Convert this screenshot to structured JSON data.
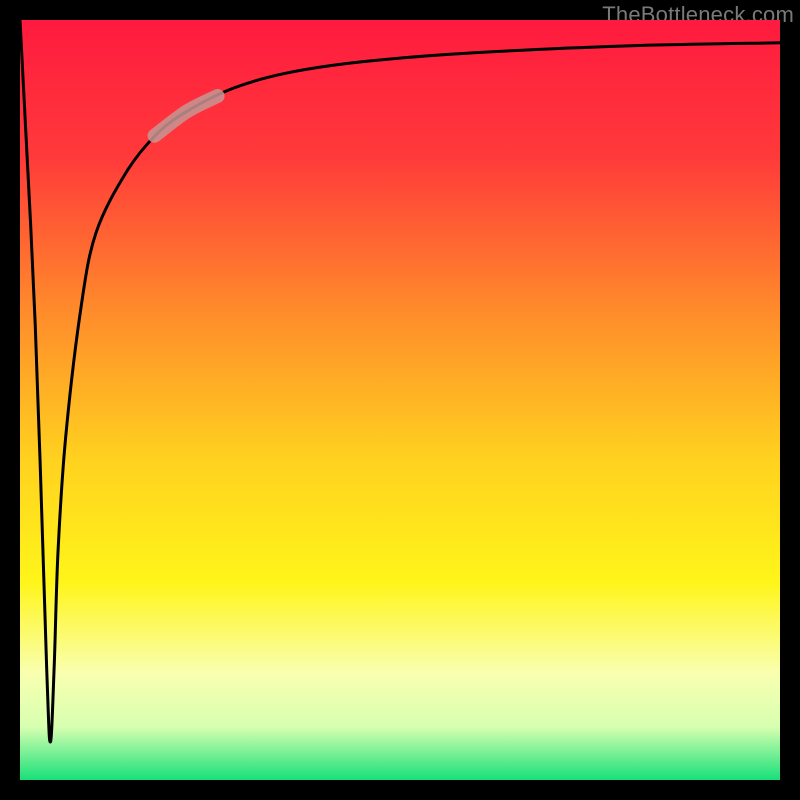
{
  "watermark": "TheBottleneck.com",
  "colors": {
    "frame_bg": "#000000",
    "watermark": "#7a7a7a",
    "curve": "#000000",
    "highlight": "#c79693",
    "gradient_stops": [
      {
        "pct": 0,
        "color": "#ff1a3f"
      },
      {
        "pct": 18,
        "color": "#ff3a3a"
      },
      {
        "pct": 38,
        "color": "#ff8a2b"
      },
      {
        "pct": 58,
        "color": "#ffd21f"
      },
      {
        "pct": 74,
        "color": "#fff51a"
      },
      {
        "pct": 86,
        "color": "#f9ffb0"
      },
      {
        "pct": 93,
        "color": "#d7ffb0"
      },
      {
        "pct": 100,
        "color": "#18e07a"
      }
    ]
  },
  "chart_data": {
    "type": "line",
    "title": "",
    "xlabel": "",
    "ylabel": "",
    "xlim": [
      0,
      100
    ],
    "ylim": [
      0,
      100
    ],
    "series": [
      {
        "name": "curve",
        "x": [
          0,
          2,
          3.5,
          4,
          4.5,
          5,
          6,
          8,
          10,
          14,
          18,
          22,
          28,
          35,
          45,
          60,
          80,
          100
        ],
        "values": [
          100,
          60,
          15,
          5,
          15,
          30,
          45,
          62,
          72,
          80,
          85,
          88,
          91,
          93,
          94.5,
          95.7,
          96.6,
          97
        ]
      }
    ],
    "highlighted_x_range": [
      18,
      26
    ],
    "annotations": []
  }
}
